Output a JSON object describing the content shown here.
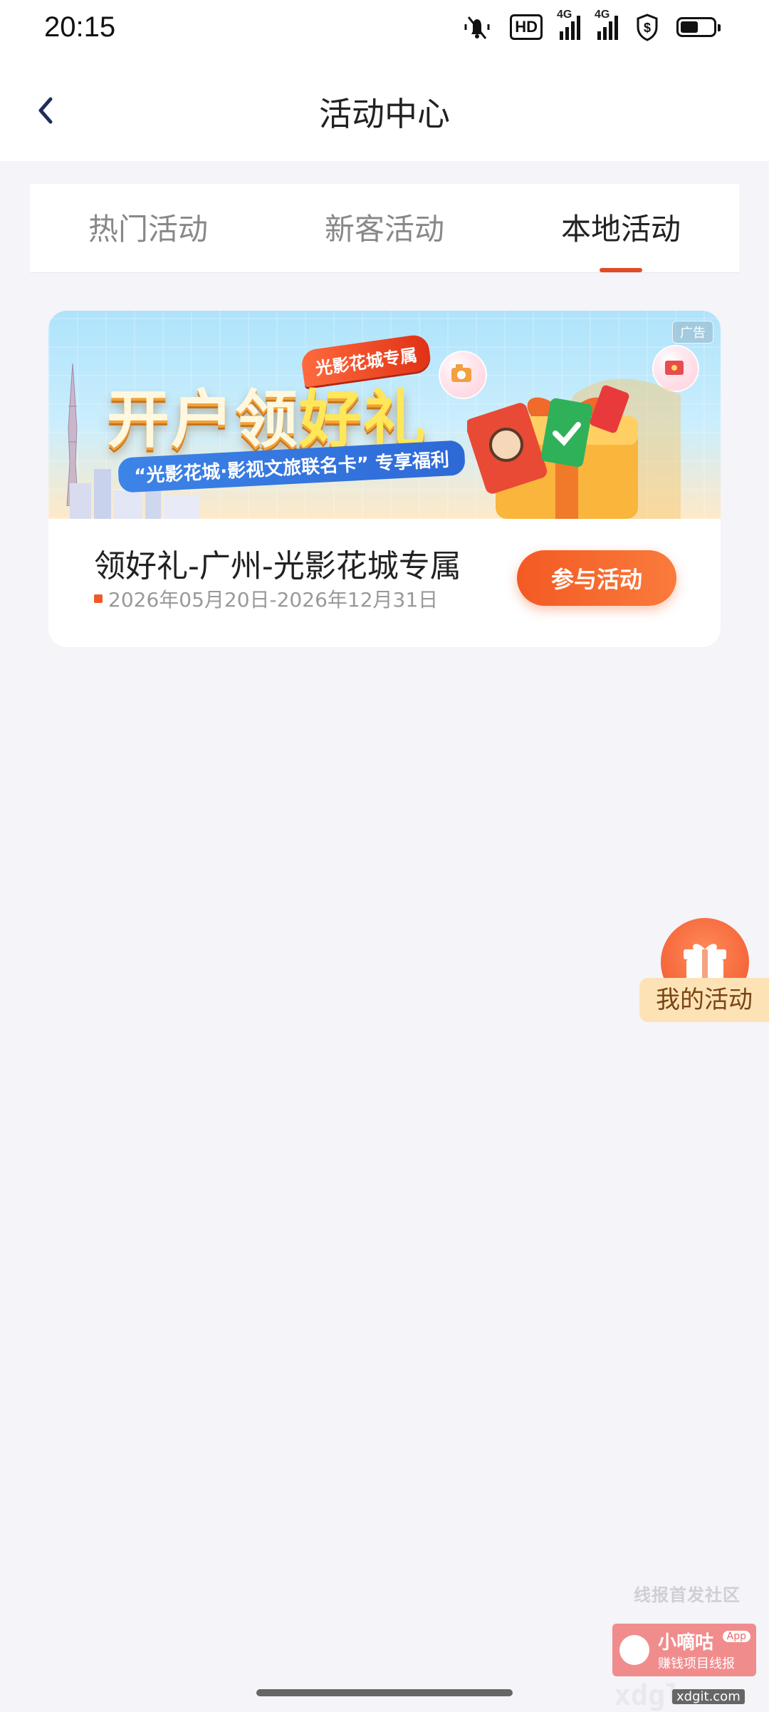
{
  "status_bar": {
    "time": "20:15",
    "icons": [
      "mute-icon",
      "hd-icon",
      "signal-4g-icon",
      "signal-4g-icon",
      "shield-icon",
      "battery-icon"
    ],
    "hd_label": "HD",
    "network_label_1": "4G",
    "network_label_2": "4G",
    "battery_level": 0.55
  },
  "header": {
    "title": "活动中心",
    "back_icon": "chevron-left-icon"
  },
  "tabs": [
    {
      "label": "热门活动",
      "active": false
    },
    {
      "label": "新客活动",
      "active": false
    },
    {
      "label": "本地活动",
      "active": true
    }
  ],
  "activity": {
    "ad_tag": "广告",
    "badge": "光影花城专属",
    "headline_part1": "开户领",
    "headline_part2": "好礼",
    "subline": "“光影花城·影视文旅联名卡” 专享福利",
    "title": "领好礼-广州-光影花城专属",
    "dates": "2026年05月20日-2026年12月31日",
    "join_label": "参与活动"
  },
  "floating": {
    "label": "我的活动",
    "icon": "gift-icon"
  },
  "watermark": {
    "top": "线报首发社区",
    "app_name": "小嘀咕",
    "app_badge": "App",
    "sub": "赚钱项目线报",
    "url": "xdgl",
    "url_small": "xdgit.com"
  },
  "colors": {
    "accent": "#e24a25",
    "button": "#f35a23",
    "background": "#f4f4f9"
  }
}
